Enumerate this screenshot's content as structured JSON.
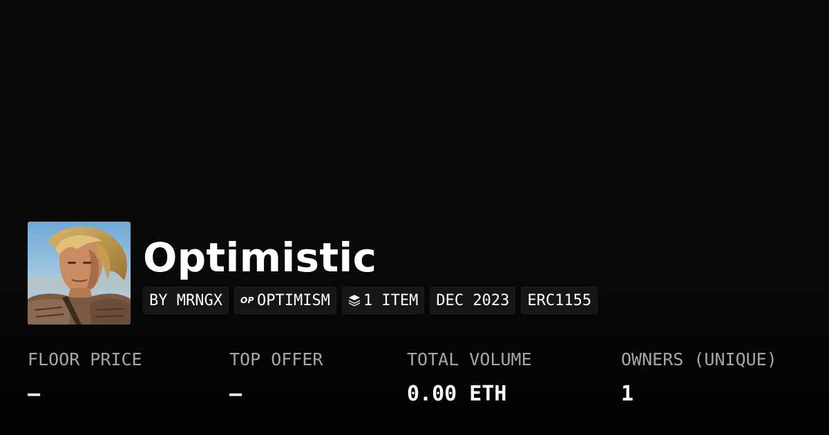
{
  "collection": {
    "name": "Optimistic",
    "avatar_icon": "portrait-avatar"
  },
  "chips": {
    "creator": "BY MRNGX",
    "chain_logo": "OP",
    "chain": "OPTIMISM",
    "item_icon": "layers-icon",
    "items": "1 ITEM",
    "date": "DEC 2023",
    "standard": "ERC1155"
  },
  "stats": {
    "floor_price": {
      "label": "FLOOR PRICE",
      "value": "—"
    },
    "top_offer": {
      "label": "TOP OFFER",
      "value": "—"
    },
    "total_volume": {
      "label": "TOTAL VOLUME",
      "value": "0.00 ETH"
    },
    "owners": {
      "label": "OWNERS (UNIQUE)",
      "value": "1"
    }
  },
  "colors": {
    "background": "#0a0a0a",
    "chip_background": "#161616",
    "label_gray": "#a7a7a7",
    "text": "#ffffff"
  }
}
